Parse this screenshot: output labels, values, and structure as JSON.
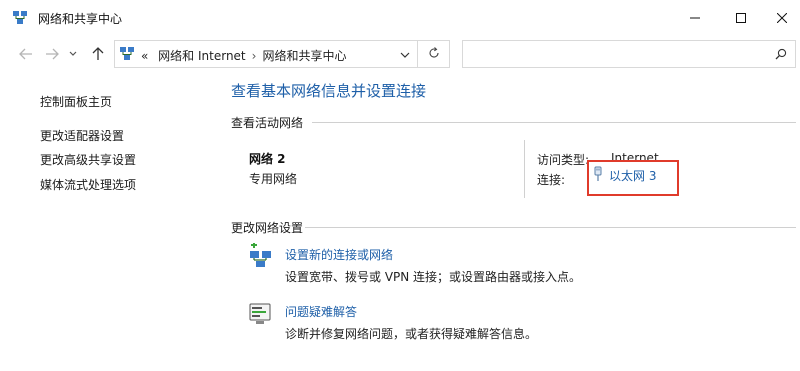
{
  "window": {
    "title": "网络和共享中心"
  },
  "address": {
    "overflow": "«",
    "crumbs": [
      "网络和 Internet",
      "网络和共享中心"
    ],
    "separator": "›"
  },
  "search": {
    "placeholder": ""
  },
  "sidebar": {
    "items": [
      {
        "label": "控制面板主页"
      },
      {
        "label": "更改适配器设置"
      },
      {
        "label": "更改高级共享设置"
      },
      {
        "label": "媒体流式处理选项"
      }
    ]
  },
  "main": {
    "title": "查看基本网络信息并设置连接",
    "active_section": "查看活动网络",
    "network": {
      "name": "网络 2",
      "type": "专用网络",
      "access_label": "访问类型:",
      "access_value": "Internet",
      "connection_label": "连接:",
      "connection_value": "以太网 3"
    },
    "change_section": "更改网络设置",
    "tasks": [
      {
        "title": "设置新的连接或网络",
        "desc": "设置宽带、拨号或 VPN 连接；或设置路由器或接入点。"
      },
      {
        "title": "问题疑难解答",
        "desc": "诊断并修复网络问题，或者获得疑难解答信息。"
      }
    ]
  },
  "colors": {
    "link": "#1e5fa8",
    "highlight": "#e03b2b"
  }
}
